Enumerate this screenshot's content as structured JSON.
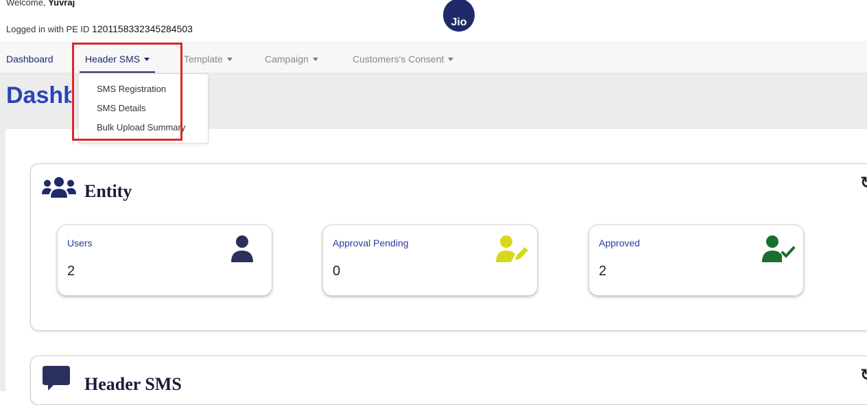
{
  "header": {
    "welcome_prefix": "Welcome,",
    "user_name": "Yuvraj",
    "pe_label": "Logged in with PE ID",
    "pe_id": "1201158332345284503",
    "logo_text": "Jio"
  },
  "nav": {
    "dashboard": "Dashboard",
    "header_sms": "Header SMS",
    "template": "Template",
    "campaign": "Campaign",
    "consent": "Customers's Consent"
  },
  "dropdown": {
    "items": [
      "SMS Registration",
      "SMS Details",
      "Bulk Upload Summary"
    ]
  },
  "page": {
    "title": "Dashboard"
  },
  "entity": {
    "title": "Entity",
    "cards": [
      {
        "label": "Users",
        "value": "2",
        "icon": "user-icon",
        "color": "#2b2f5e"
      },
      {
        "label": "Approval Pending",
        "value": "0",
        "icon": "user-edit-icon",
        "color": "#d8d81a"
      },
      {
        "label": "Approved",
        "value": "2",
        "icon": "user-check-icon",
        "color": "#1a6e2e"
      }
    ]
  },
  "header_sms_section": {
    "title": "Header SMS"
  },
  "colors": {
    "brand": "#1f2a6b",
    "title_blue": "#2a44b8",
    "highlight_red": "#e0232c"
  }
}
